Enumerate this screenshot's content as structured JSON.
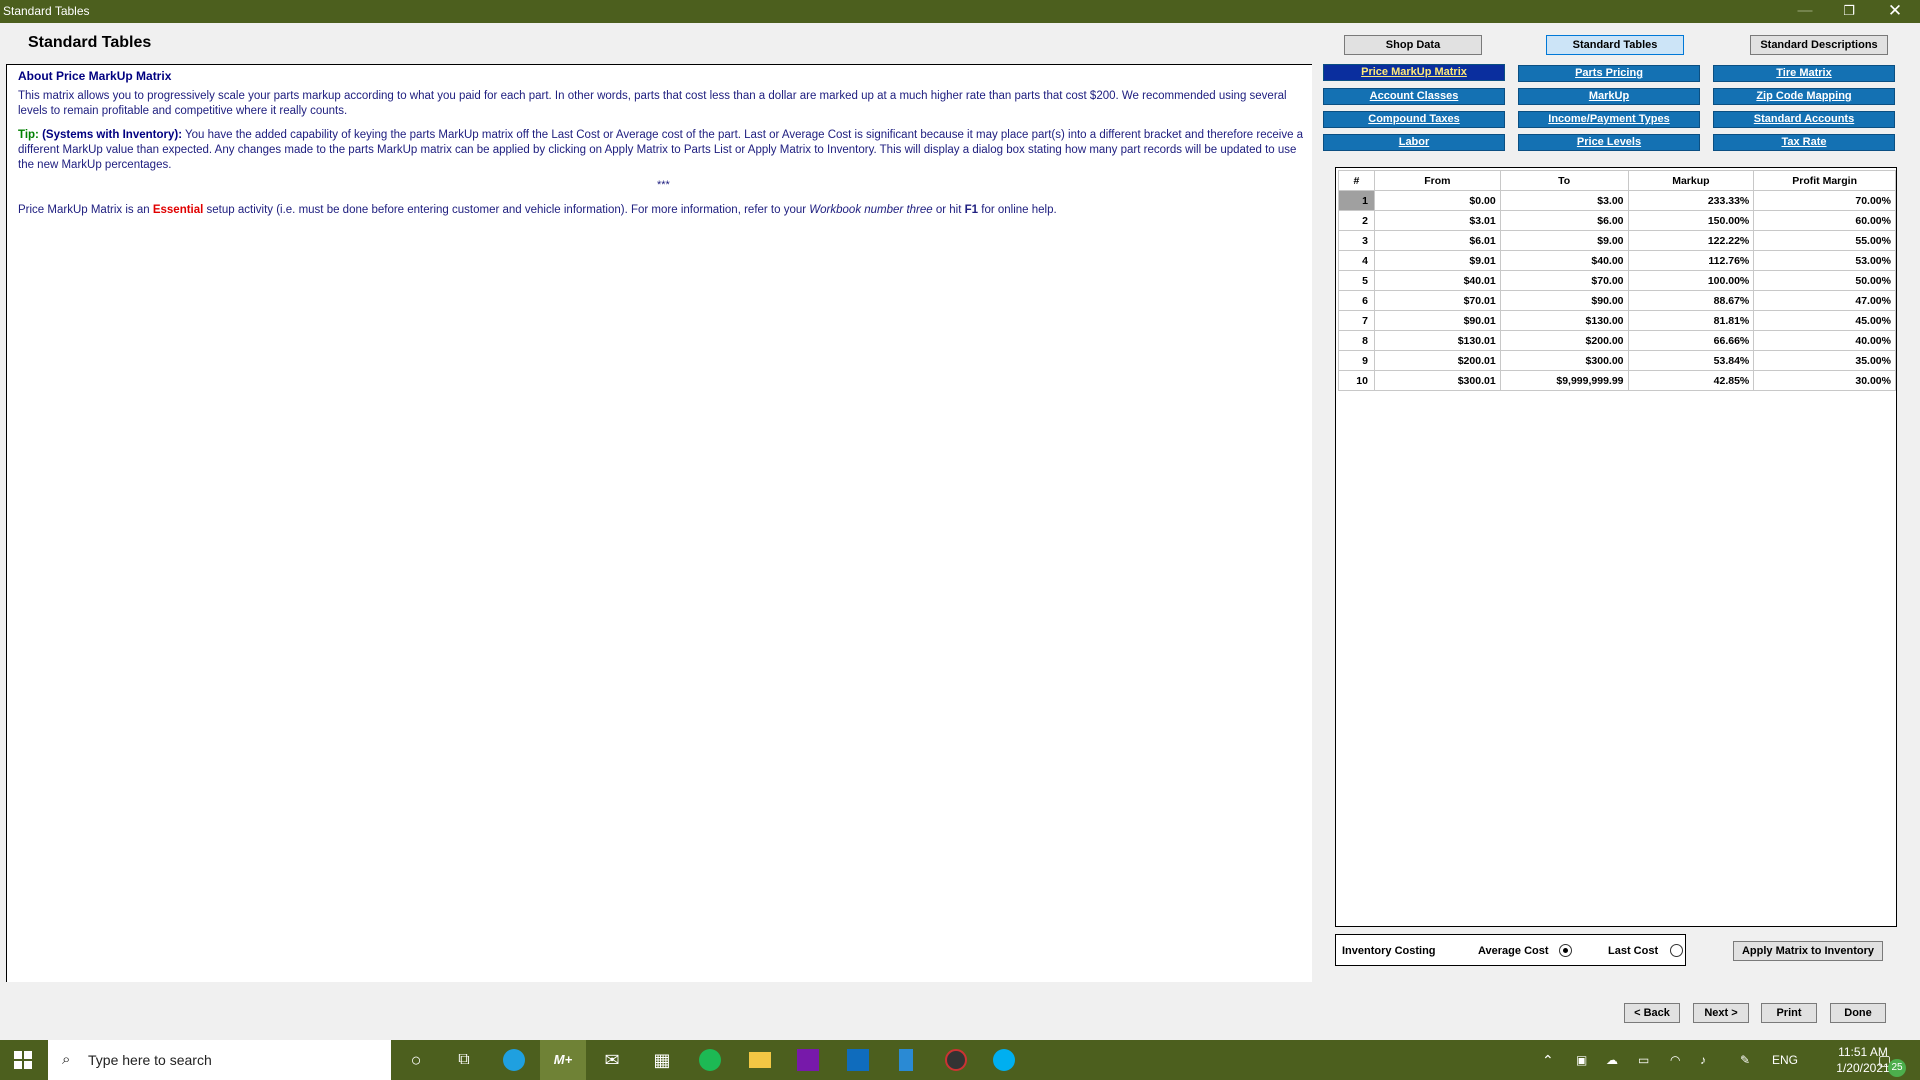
{
  "window": {
    "title": "Standard Tables",
    "minimize": "—",
    "restore": "❐",
    "close": "✕"
  },
  "page_title": "Standard Tables",
  "top_tabs": {
    "shop_data": "Shop Data",
    "standard_tables": "Standard Tables",
    "standard_descriptions": "Standard Descriptions"
  },
  "about": {
    "heading": "About Price MarkUp Matrix",
    "para1": "This matrix allows you to progressively scale your parts markup according to what you paid for each part. In other words, parts that cost less than a dollar are marked up at a much higher rate than parts that cost $200. We recommended using several levels to remain profitable and competitive where it really counts.",
    "tip_label": "Tip:",
    "tip_title": "(Systems with Inventory):",
    "tip_text": " You have the added capability of keying the parts MarkUp matrix off the Last Cost or Average cost of the part. Last or Average Cost is significant because it may place part(s) into a different bracket and therefore receive a different MarkUp value than expected. Any changes made to the parts MarkUp matrix can be applied by clicking on Apply Matrix to Parts List or Apply Matrix to Inventory. This will display a dialog box stating how many part records will be updated to use the new MarkUp percentages.",
    "stars": "***",
    "ess_pre": "Price MarkUp Matrix is an ",
    "ess_word": "Essential",
    "ess_mid": " setup activity (i.e. must be done before entering customer and vehicle information). For more information, refer to your ",
    "ess_book": "Workbook number three",
    "ess_mid2": " or hit ",
    "ess_key": "F1",
    "ess_post": " for online help."
  },
  "modules": [
    [
      "Price MarkUp Matrix",
      "Parts Pricing",
      "Tire Matrix"
    ],
    [
      "Account Classes",
      "MarkUp",
      "Zip Code Mapping"
    ],
    [
      "Compound Taxes",
      "Income/Payment Types",
      "Standard Accounts"
    ],
    [
      "Labor",
      "Price Levels",
      "Tax Rate"
    ]
  ],
  "table": {
    "headers": [
      "#",
      "From",
      "To",
      "Markup",
      "Profit Margin"
    ],
    "rows": [
      [
        "1",
        "$0.00",
        "$3.00",
        "233.33%",
        "70.00%"
      ],
      [
        "2",
        "$3.01",
        "$6.00",
        "150.00%",
        "60.00%"
      ],
      [
        "3",
        "$6.01",
        "$9.00",
        "122.22%",
        "55.00%"
      ],
      [
        "4",
        "$9.01",
        "$40.00",
        "112.76%",
        "53.00%"
      ],
      [
        "5",
        "$40.01",
        "$70.00",
        "100.00%",
        "50.00%"
      ],
      [
        "6",
        "$70.01",
        "$90.00",
        "88.67%",
        "47.00%"
      ],
      [
        "7",
        "$90.01",
        "$130.00",
        "81.81%",
        "45.00%"
      ],
      [
        "8",
        "$130.01",
        "$200.00",
        "66.66%",
        "40.00%"
      ],
      [
        "9",
        "$200.01",
        "$300.00",
        "53.84%",
        "35.00%"
      ],
      [
        "10",
        "$300.01",
        "$9,999,999.99",
        "42.85%",
        "30.00%"
      ]
    ]
  },
  "costing": {
    "label": "Inventory Costing",
    "average": "Average Cost",
    "last": "Last Cost",
    "selected": "Average Cost"
  },
  "buttons": {
    "apply": "Apply Matrix to Inventory",
    "back": "< Back",
    "next": "Next >",
    "print": "Print",
    "done": "Done"
  },
  "taskbar": {
    "search_placeholder": "Type here to search",
    "language": "ENG",
    "time": "11:51 AM",
    "date": "1/20/2021",
    "notification_count": "25"
  }
}
